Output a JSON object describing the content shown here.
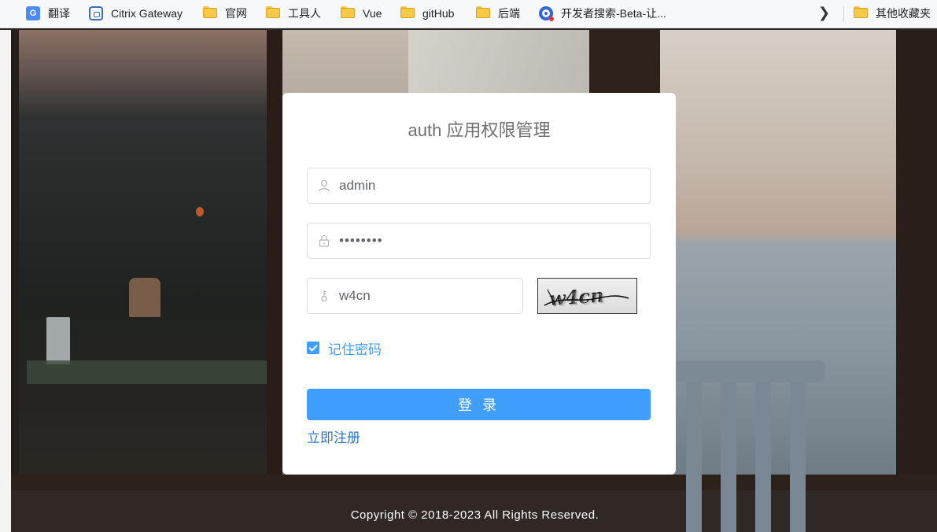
{
  "bookmarks": [
    {
      "label": "翻译",
      "icon": "translate-icon"
    },
    {
      "label": "Citrix Gateway",
      "icon": "citrix-icon"
    },
    {
      "label": "官网",
      "icon": "folder-icon"
    },
    {
      "label": "工具人",
      "icon": "folder-icon"
    },
    {
      "label": "Vue",
      "icon": "folder-icon"
    },
    {
      "label": "gitHub",
      "icon": "folder-icon"
    },
    {
      "label": "后端",
      "icon": "folder-icon"
    },
    {
      "label": "开发者搜索-Beta-让...",
      "icon": "dev-search-icon"
    },
    {
      "label": "其他收藏夹",
      "icon": "folder-icon"
    }
  ],
  "login": {
    "title": "auth 应用权限管理",
    "username_value": "admin",
    "password_value": "••••••••",
    "captcha_input_value": "w4cn",
    "captcha_image_text": "w4cn",
    "remember_label": "记住密码",
    "remember_checked": true,
    "login_button": "登 录",
    "register_link": "立即注册"
  },
  "footer": {
    "copyright": "Copyright © 2018-2023 All Rights Reserved."
  },
  "colors": {
    "primary": "#409eff",
    "link": "#2f74c8",
    "border": "#dcdfe6",
    "title": "#707070"
  }
}
